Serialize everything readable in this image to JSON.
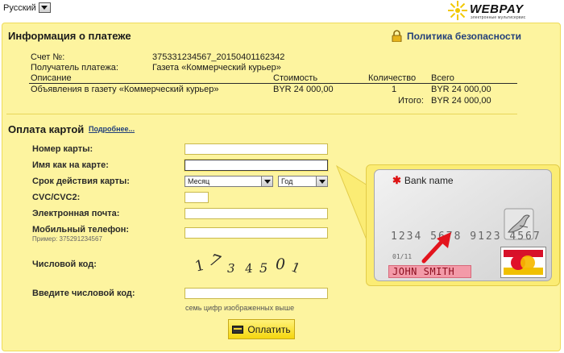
{
  "header": {
    "language": "Русский",
    "logo_text": "WEBPAY",
    "logo_subtitle": "электронные мультисервис"
  },
  "payment_info": {
    "title": "Информация о платеже",
    "policy_link": "Политика безопасности",
    "invoice_label": "Счет №:",
    "invoice_value": "375331234567_20150401162342",
    "recipient_label": "Получатель платежа:",
    "recipient_value": "Газета «Коммерческий курьер»",
    "columns": {
      "description": "Описание",
      "cost": "Стоимость",
      "quantity": "Количество",
      "total": "Всего"
    },
    "items": [
      {
        "description": "Объявления в газету «Коммерческий курьер»",
        "cost": "BYR 24 000,00",
        "quantity": "1",
        "total": "BYR 24 000,00"
      }
    ],
    "grand_total_label": "Итого:",
    "grand_total_value": "BYR 24 000,00"
  },
  "card_payment": {
    "title": "Оплата картой",
    "more_link": "Подробнее...",
    "card_number_label": "Номер карты:",
    "card_name_label": "Имя как на карте:",
    "expiry_label": "Срок действия карты:",
    "month_select": "Месяц",
    "year_select": "Год",
    "cvc_label": "CVC/CVC2:",
    "email_label": "Электронная почта:",
    "phone_label": "Мобильный телефон:",
    "phone_hint": "Пример: 375291234567",
    "captcha_label": "Числовой код:",
    "captcha_image_text": "1734501",
    "enter_code_label": "Введите числовой код:",
    "code_caption": "семь цифр изображенных выше",
    "pay_button": "Оплатить"
  },
  "card_illustration": {
    "bank_name": "Bank name",
    "card_number": "1234 5678 9123 4567",
    "expiry": "01/11",
    "holder_name": "JOHN SMITH"
  },
  "colors": {
    "panel_bg": "#fdf49f",
    "link": "#23407a",
    "highlight_holder": "#f39aa8",
    "arrow": "#e3141d"
  }
}
